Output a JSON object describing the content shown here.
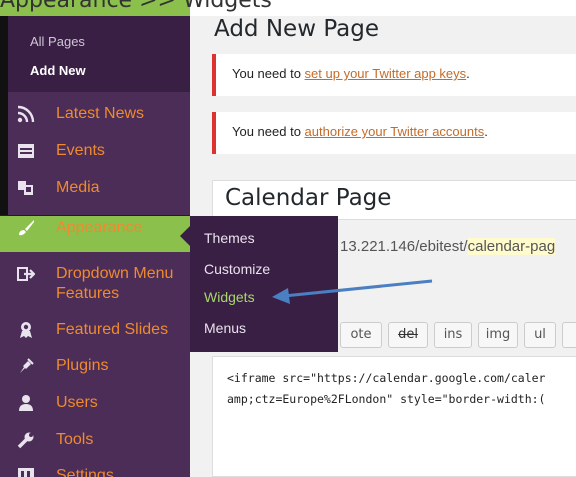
{
  "top_strip": {
    "text": "Appearance  >>  Widgets"
  },
  "sidebar": {
    "sub_items": [
      {
        "label": "All Pages"
      },
      {
        "label": "Add New"
      }
    ],
    "items": [
      {
        "label": "Latest News",
        "icon": "rss-icon"
      },
      {
        "label": "Events",
        "icon": "calendar-icon"
      },
      {
        "label": "Media",
        "icon": "media-icon"
      },
      {
        "label": "Appearance",
        "icon": "paintbrush-icon"
      },
      {
        "label": "Dropdown Menu\nFeatures",
        "label_line1": "Dropdown Menu",
        "label_line2": "Features",
        "icon": "dropdown-icon"
      },
      {
        "label": "Featured Slides",
        "icon": "award-icon"
      },
      {
        "label": "Plugins",
        "icon": "plugin-icon"
      },
      {
        "label": "Users",
        "icon": "user-icon"
      },
      {
        "label": "Tools",
        "icon": "wrench-icon"
      },
      {
        "label": "Settings",
        "icon": "settings-icon"
      }
    ]
  },
  "flyout": {
    "items": [
      {
        "label": "Themes"
      },
      {
        "label": "Customize"
      },
      {
        "label": "Widgets"
      },
      {
        "label": "Menus"
      }
    ]
  },
  "main": {
    "title": "Add New Page",
    "notices": [
      {
        "prefix": "You need to ",
        "link": "set up your Twitter app keys",
        "suffix": "."
      },
      {
        "prefix": "You need to ",
        "link": "authorize your Twitter accounts",
        "suffix": "."
      }
    ],
    "post_title": "Calendar Page",
    "permalink_base": "13.221.146/ebitest/",
    "permalink_slug": "calendar-pag",
    "quicktags": [
      "ote",
      "del",
      "ins",
      "img",
      "ul"
    ],
    "code_lines": [
      "<iframe src=\"https://calendar.google.com/caler",
      "amp;ctz=Europe%2FLondon\" style=\"border-width:("
    ]
  },
  "colors": {
    "sidebar_bg": "#4b2d57",
    "submenu_bg": "#3a1f45",
    "accent_green": "#8cc04c",
    "menu_label": "#ef8a2e",
    "link": "#c46b27",
    "notice_border": "#dc3232",
    "arrow": "#4a7fc1"
  }
}
